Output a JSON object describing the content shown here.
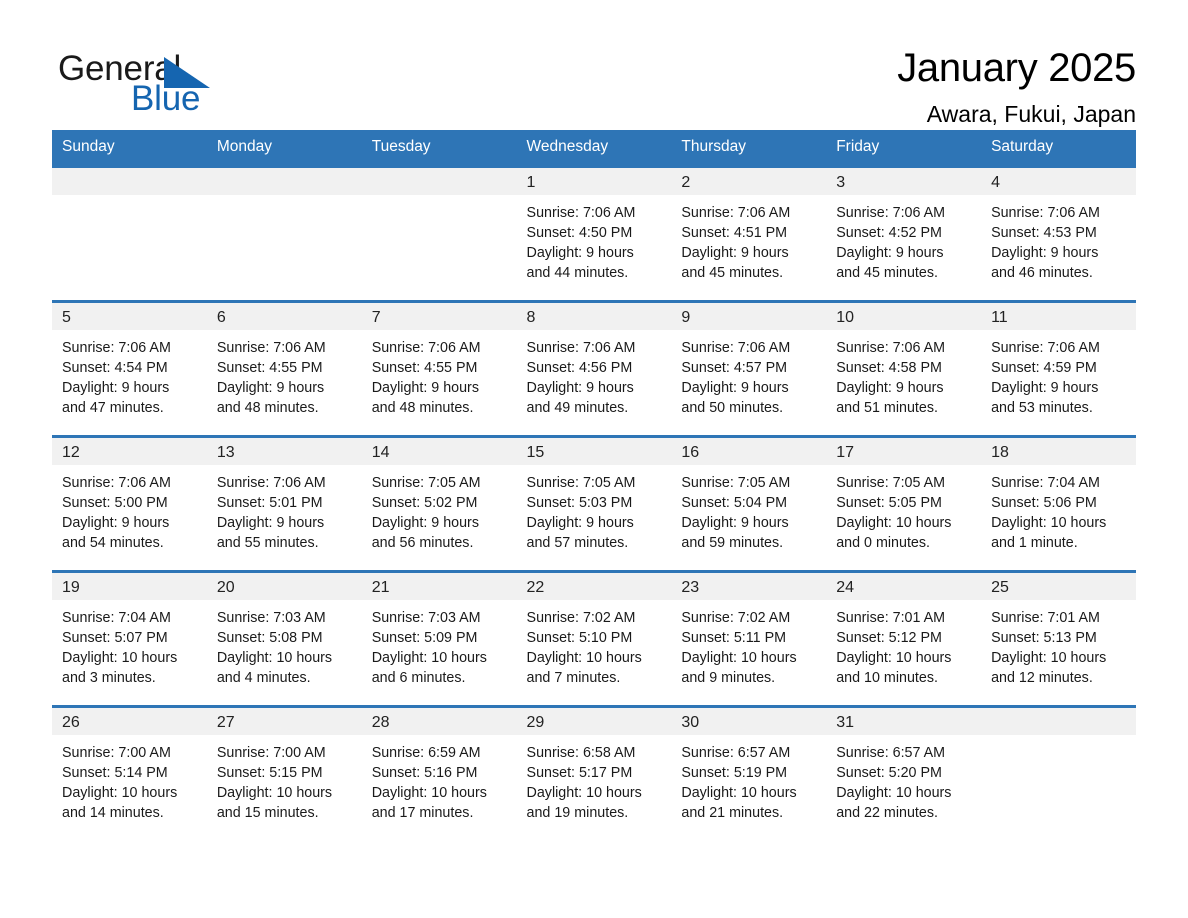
{
  "brand": {
    "word_general": "General",
    "word_blue": "Blue",
    "triangle_color": "#1565b0",
    "text_color": "#1a1a1a"
  },
  "header": {
    "title": "January 2025",
    "subtitle": "Awara, Fukui, Japan"
  },
  "theme": {
    "header_blue": "#2e75b6",
    "row_rule_blue": "#2e75b6",
    "daynum_band": "#f1f1f1",
    "text": "#1a1a1a"
  },
  "weekday_headers": [
    "Sunday",
    "Monday",
    "Tuesday",
    "Wednesday",
    "Thursday",
    "Friday",
    "Saturday"
  ],
  "labels": {
    "sunrise_prefix": "Sunrise: ",
    "sunset_prefix": "Sunset: ",
    "daylight_prefix": "Daylight: "
  },
  "weeks": [
    [
      {
        "day": "",
        "blank": true,
        "sunrise": "",
        "sunset": "",
        "daylight_line1": "",
        "daylight_line2": ""
      },
      {
        "day": "",
        "blank": true,
        "sunrise": "",
        "sunset": "",
        "daylight_line1": "",
        "daylight_line2": ""
      },
      {
        "day": "",
        "blank": true,
        "sunrise": "",
        "sunset": "",
        "daylight_line1": "",
        "daylight_line2": ""
      },
      {
        "day": "1",
        "blank": false,
        "sunrise": "Sunrise: 7:06 AM",
        "sunset": "Sunset: 4:50 PM",
        "daylight_line1": "Daylight: 9 hours",
        "daylight_line2": "and 44 minutes."
      },
      {
        "day": "2",
        "blank": false,
        "sunrise": "Sunrise: 7:06 AM",
        "sunset": "Sunset: 4:51 PM",
        "daylight_line1": "Daylight: 9 hours",
        "daylight_line2": "and 45 minutes."
      },
      {
        "day": "3",
        "blank": false,
        "sunrise": "Sunrise: 7:06 AM",
        "sunset": "Sunset: 4:52 PM",
        "daylight_line1": "Daylight: 9 hours",
        "daylight_line2": "and 45 minutes."
      },
      {
        "day": "4",
        "blank": false,
        "sunrise": "Sunrise: 7:06 AM",
        "sunset": "Sunset: 4:53 PM",
        "daylight_line1": "Daylight: 9 hours",
        "daylight_line2": "and 46 minutes."
      }
    ],
    [
      {
        "day": "5",
        "blank": false,
        "sunrise": "Sunrise: 7:06 AM",
        "sunset": "Sunset: 4:54 PM",
        "daylight_line1": "Daylight: 9 hours",
        "daylight_line2": "and 47 minutes."
      },
      {
        "day": "6",
        "blank": false,
        "sunrise": "Sunrise: 7:06 AM",
        "sunset": "Sunset: 4:55 PM",
        "daylight_line1": "Daylight: 9 hours",
        "daylight_line2": "and 48 minutes."
      },
      {
        "day": "7",
        "blank": false,
        "sunrise": "Sunrise: 7:06 AM",
        "sunset": "Sunset: 4:55 PM",
        "daylight_line1": "Daylight: 9 hours",
        "daylight_line2": "and 48 minutes."
      },
      {
        "day": "8",
        "blank": false,
        "sunrise": "Sunrise: 7:06 AM",
        "sunset": "Sunset: 4:56 PM",
        "daylight_line1": "Daylight: 9 hours",
        "daylight_line2": "and 49 minutes."
      },
      {
        "day": "9",
        "blank": false,
        "sunrise": "Sunrise: 7:06 AM",
        "sunset": "Sunset: 4:57 PM",
        "daylight_line1": "Daylight: 9 hours",
        "daylight_line2": "and 50 minutes."
      },
      {
        "day": "10",
        "blank": false,
        "sunrise": "Sunrise: 7:06 AM",
        "sunset": "Sunset: 4:58 PM",
        "daylight_line1": "Daylight: 9 hours",
        "daylight_line2": "and 51 minutes."
      },
      {
        "day": "11",
        "blank": false,
        "sunrise": "Sunrise: 7:06 AM",
        "sunset": "Sunset: 4:59 PM",
        "daylight_line1": "Daylight: 9 hours",
        "daylight_line2": "and 53 minutes."
      }
    ],
    [
      {
        "day": "12",
        "blank": false,
        "sunrise": "Sunrise: 7:06 AM",
        "sunset": "Sunset: 5:00 PM",
        "daylight_line1": "Daylight: 9 hours",
        "daylight_line2": "and 54 minutes."
      },
      {
        "day": "13",
        "blank": false,
        "sunrise": "Sunrise: 7:06 AM",
        "sunset": "Sunset: 5:01 PM",
        "daylight_line1": "Daylight: 9 hours",
        "daylight_line2": "and 55 minutes."
      },
      {
        "day": "14",
        "blank": false,
        "sunrise": "Sunrise: 7:05 AM",
        "sunset": "Sunset: 5:02 PM",
        "daylight_line1": "Daylight: 9 hours",
        "daylight_line2": "and 56 minutes."
      },
      {
        "day": "15",
        "blank": false,
        "sunrise": "Sunrise: 7:05 AM",
        "sunset": "Sunset: 5:03 PM",
        "daylight_line1": "Daylight: 9 hours",
        "daylight_line2": "and 57 minutes."
      },
      {
        "day": "16",
        "blank": false,
        "sunrise": "Sunrise: 7:05 AM",
        "sunset": "Sunset: 5:04 PM",
        "daylight_line1": "Daylight: 9 hours",
        "daylight_line2": "and 59 minutes."
      },
      {
        "day": "17",
        "blank": false,
        "sunrise": "Sunrise: 7:05 AM",
        "sunset": "Sunset: 5:05 PM",
        "daylight_line1": "Daylight: 10 hours",
        "daylight_line2": "and 0 minutes."
      },
      {
        "day": "18",
        "blank": false,
        "sunrise": "Sunrise: 7:04 AM",
        "sunset": "Sunset: 5:06 PM",
        "daylight_line1": "Daylight: 10 hours",
        "daylight_line2": "and 1 minute."
      }
    ],
    [
      {
        "day": "19",
        "blank": false,
        "sunrise": "Sunrise: 7:04 AM",
        "sunset": "Sunset: 5:07 PM",
        "daylight_line1": "Daylight: 10 hours",
        "daylight_line2": "and 3 minutes."
      },
      {
        "day": "20",
        "blank": false,
        "sunrise": "Sunrise: 7:03 AM",
        "sunset": "Sunset: 5:08 PM",
        "daylight_line1": "Daylight: 10 hours",
        "daylight_line2": "and 4 minutes."
      },
      {
        "day": "21",
        "blank": false,
        "sunrise": "Sunrise: 7:03 AM",
        "sunset": "Sunset: 5:09 PM",
        "daylight_line1": "Daylight: 10 hours",
        "daylight_line2": "and 6 minutes."
      },
      {
        "day": "22",
        "blank": false,
        "sunrise": "Sunrise: 7:02 AM",
        "sunset": "Sunset: 5:10 PM",
        "daylight_line1": "Daylight: 10 hours",
        "daylight_line2": "and 7 minutes."
      },
      {
        "day": "23",
        "blank": false,
        "sunrise": "Sunrise: 7:02 AM",
        "sunset": "Sunset: 5:11 PM",
        "daylight_line1": "Daylight: 10 hours",
        "daylight_line2": "and 9 minutes."
      },
      {
        "day": "24",
        "blank": false,
        "sunrise": "Sunrise: 7:01 AM",
        "sunset": "Sunset: 5:12 PM",
        "daylight_line1": "Daylight: 10 hours",
        "daylight_line2": "and 10 minutes."
      },
      {
        "day": "25",
        "blank": false,
        "sunrise": "Sunrise: 7:01 AM",
        "sunset": "Sunset: 5:13 PM",
        "daylight_line1": "Daylight: 10 hours",
        "daylight_line2": "and 12 minutes."
      }
    ],
    [
      {
        "day": "26",
        "blank": false,
        "sunrise": "Sunrise: 7:00 AM",
        "sunset": "Sunset: 5:14 PM",
        "daylight_line1": "Daylight: 10 hours",
        "daylight_line2": "and 14 minutes."
      },
      {
        "day": "27",
        "blank": false,
        "sunrise": "Sunrise: 7:00 AM",
        "sunset": "Sunset: 5:15 PM",
        "daylight_line1": "Daylight: 10 hours",
        "daylight_line2": "and 15 minutes."
      },
      {
        "day": "28",
        "blank": false,
        "sunrise": "Sunrise: 6:59 AM",
        "sunset": "Sunset: 5:16 PM",
        "daylight_line1": "Daylight: 10 hours",
        "daylight_line2": "and 17 minutes."
      },
      {
        "day": "29",
        "blank": false,
        "sunrise": "Sunrise: 6:58 AM",
        "sunset": "Sunset: 5:17 PM",
        "daylight_line1": "Daylight: 10 hours",
        "daylight_line2": "and 19 minutes."
      },
      {
        "day": "30",
        "blank": false,
        "sunrise": "Sunrise: 6:57 AM",
        "sunset": "Sunset: 5:19 PM",
        "daylight_line1": "Daylight: 10 hours",
        "daylight_line2": "and 21 minutes."
      },
      {
        "day": "31",
        "blank": false,
        "sunrise": "Sunrise: 6:57 AM",
        "sunset": "Sunset: 5:20 PM",
        "daylight_line1": "Daylight: 10 hours",
        "daylight_line2": "and 22 minutes."
      },
      {
        "day": "",
        "blank": true,
        "sunrise": "",
        "sunset": "",
        "daylight_line1": "",
        "daylight_line2": ""
      }
    ]
  ]
}
